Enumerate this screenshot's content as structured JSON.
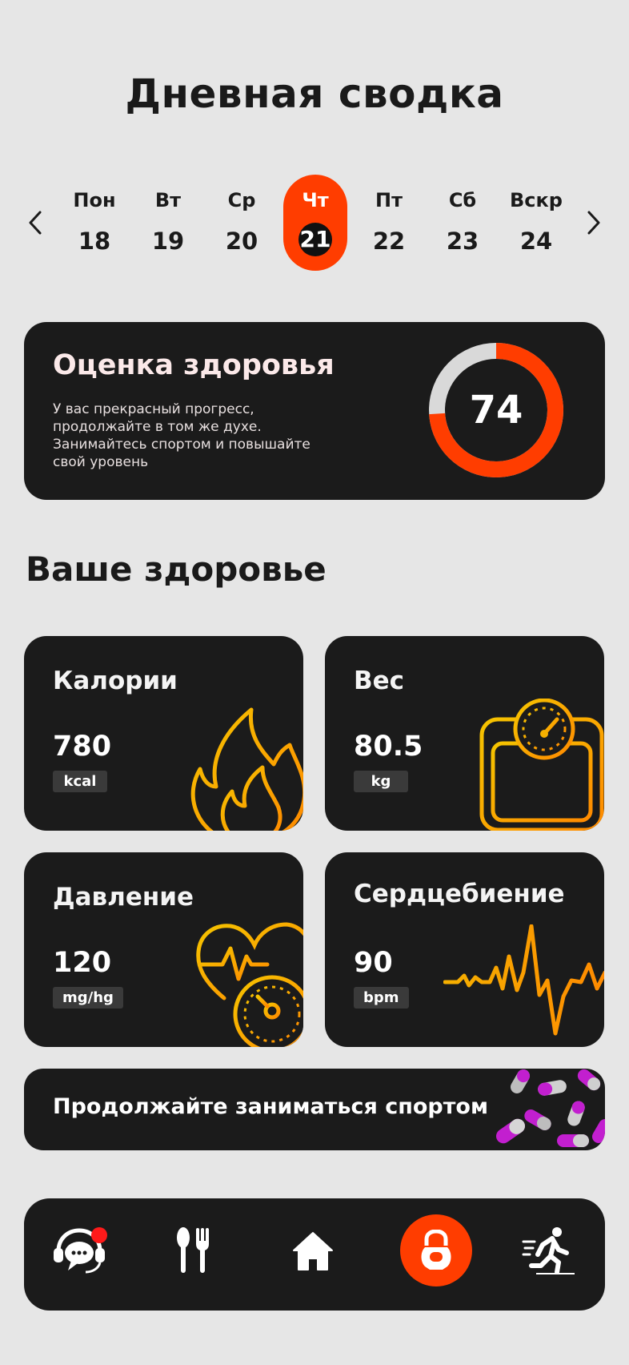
{
  "header": {
    "title": "Дневная сводка"
  },
  "week": {
    "days": [
      {
        "name": "Пон",
        "num": "18"
      },
      {
        "name": "Вт",
        "num": "19"
      },
      {
        "name": "Ср",
        "num": "20"
      },
      {
        "name": "Чт",
        "num": "21"
      },
      {
        "name": "Пт",
        "num": "22"
      },
      {
        "name": "Сб",
        "num": "23"
      },
      {
        "name": "Вскр",
        "num": "24"
      }
    ],
    "active_index": 3
  },
  "score": {
    "title": "Оценка здоровья",
    "description": "У вас прекрасный прогресс, продолжайте в том же духе. Занимайтесь спортом и повышайте свой уровень",
    "value": "74",
    "fraction": 0.74
  },
  "section": {
    "title": "Ваше здоровье"
  },
  "metrics": [
    {
      "title": "Калории",
      "value": "780",
      "unit": "kcal",
      "icon": "flame-icon"
    },
    {
      "title": "Вес",
      "value": "80.5",
      "unit": "kg",
      "icon": "scale-icon"
    },
    {
      "title": "Давление",
      "value": "120",
      "unit": "mg/hg",
      "icon": "heart-gauge-icon"
    },
    {
      "title": "Сердцебиение",
      "value": "90",
      "unit": "bpm",
      "icon": "heartbeat-icon"
    }
  ],
  "promo": {
    "text": "Продолжайте заниматься спортом",
    "image": "pills-image"
  },
  "nav": {
    "items": [
      {
        "icon": "chat-support-icon",
        "badge": true
      },
      {
        "icon": "fork-spoon-icon"
      },
      {
        "icon": "home-icon"
      },
      {
        "icon": "kettlebell-icon",
        "active": true
      },
      {
        "icon": "runner-icon"
      }
    ]
  },
  "colors": {
    "accent": "#ff3d00",
    "card_bg": "#1b1b1b",
    "page_bg": "#e6e6e6",
    "ring_track": "#d9d9d9",
    "icon_gradient_start": "#f5c400",
    "icon_gradient_end": "#ff8a00"
  }
}
